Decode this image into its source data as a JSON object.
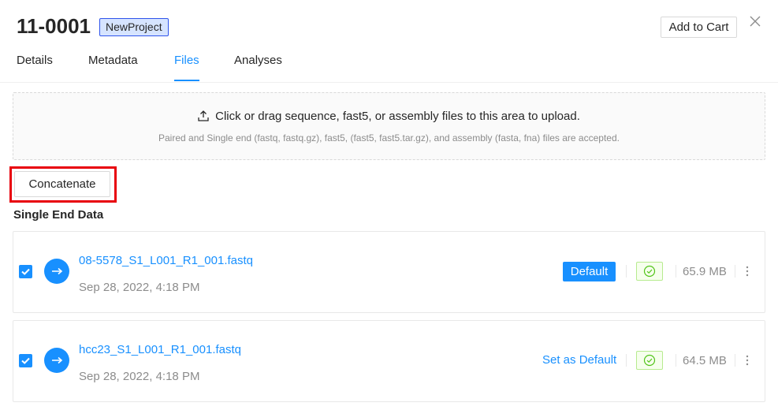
{
  "header": {
    "title": "11-0001",
    "project_tag": "NewProject",
    "add_to_cart_label": "Add to Cart",
    "close_icon": "close-icon"
  },
  "tabs": [
    {
      "label": "Details",
      "active": false
    },
    {
      "label": "Metadata",
      "active": false
    },
    {
      "label": "Files",
      "active": true
    },
    {
      "label": "Analyses",
      "active": false
    }
  ],
  "upload": {
    "icon": "upload-icon",
    "main_text": "Click or drag sequence, fast5, or assembly files to this area to upload.",
    "hint_text": "Paired and Single end (fastq, fastq.gz), fast5, (fast5, fast5.tar.gz), and assembly (fasta, fna) files are accepted."
  },
  "concatenate_label": "Concatenate",
  "section_title": "Single End Data",
  "files": [
    {
      "name": "08-5578_S1_L001_R1_001.fastq",
      "date": "Sep 28, 2022, 4:18 PM",
      "checked": true,
      "is_default": true,
      "default_label": "Default",
      "qc_icon": "check-circle-icon",
      "size": "65.9 MB"
    },
    {
      "name": "hcc23_S1_L001_R1_001.fastq",
      "date": "Sep 28, 2022, 4:18 PM",
      "checked": true,
      "is_default": false,
      "set_default_label": "Set as Default",
      "qc_icon": "check-circle-icon",
      "size": "64.5 MB"
    }
  ],
  "colors": {
    "primary": "#1890ff",
    "highlight": "#e8000b",
    "qc_green": "#52c41a"
  }
}
